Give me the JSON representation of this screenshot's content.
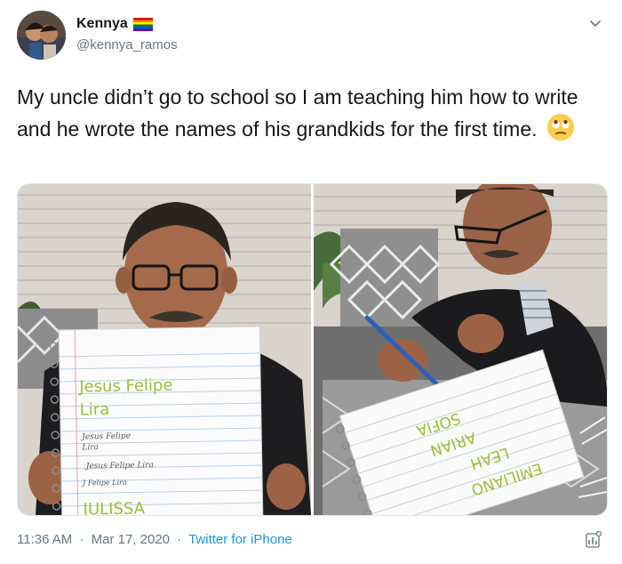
{
  "user": {
    "display_name": "Kennya",
    "handle": "@kennya_ramos",
    "flag_icon": "rainbow-flag-icon"
  },
  "tweet": {
    "text": "My uncle didn’t go to school so I am teaching him how to write and he wrote the names of his grandkids for the first time.",
    "emoji_icon": "face-with-rolling-eyes-icon"
  },
  "media": {
    "left_notebook_lines": [
      "Jesus Felipe",
      "Lira",
      "Jesus   Felipe",
      "Lira",
      "Jesus Felipe Lira",
      "J Felipe Lira",
      "JULISSA"
    ],
    "right_notebook_lines": [
      "EMILIANO",
      "LEAH",
      "ARIAN",
      "SOFIA"
    ]
  },
  "footer": {
    "time": "11:36 AM",
    "separator": "·",
    "date": "Mar 17, 2020",
    "source": "Twitter for iPhone"
  },
  "colors": {
    "text": "#14171a",
    "secondary": "#657786",
    "link": "#1b95e0",
    "border": "#e1e8ed"
  }
}
